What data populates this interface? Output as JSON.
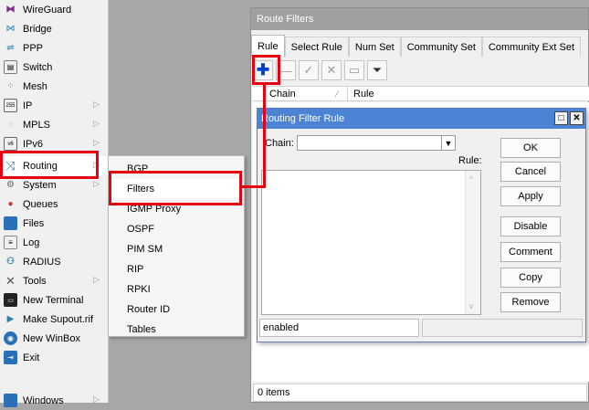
{
  "menu": {
    "items": [
      {
        "label": "WireGuard",
        "icon": "wireguard-icon",
        "arrow": false
      },
      {
        "label": "Bridge",
        "icon": "bridge-icon",
        "arrow": false
      },
      {
        "label": "PPP",
        "icon": "ppp-icon",
        "arrow": false
      },
      {
        "label": "Switch",
        "icon": "switch-icon",
        "arrow": false
      },
      {
        "label": "Mesh",
        "icon": "mesh-icon",
        "arrow": false
      },
      {
        "label": "IP",
        "icon": "ip-icon",
        "arrow": true
      },
      {
        "label": "MPLS",
        "icon": "mpls-icon",
        "arrow": true
      },
      {
        "label": "IPv6",
        "icon": "ipv6-icon",
        "arrow": true
      },
      {
        "label": "Routing",
        "icon": "routing-icon",
        "arrow": true
      },
      {
        "label": "System",
        "icon": "system-icon",
        "arrow": true
      },
      {
        "label": "Queues",
        "icon": "queues-icon",
        "arrow": false
      },
      {
        "label": "Files",
        "icon": "files-icon",
        "arrow": false
      },
      {
        "label": "Log",
        "icon": "log-icon",
        "arrow": false
      },
      {
        "label": "RADIUS",
        "icon": "radius-icon",
        "arrow": false
      },
      {
        "label": "Tools",
        "icon": "tools-icon",
        "arrow": true
      },
      {
        "label": "New Terminal",
        "icon": "terminal-icon",
        "arrow": false
      },
      {
        "label": "Make Supout.rif",
        "icon": "supout-icon",
        "arrow": false
      },
      {
        "label": "New WinBox",
        "icon": "winbox-icon",
        "arrow": false
      },
      {
        "label": "Exit",
        "icon": "exit-icon",
        "arrow": false
      },
      {
        "label": "Windows",
        "icon": "windows-icon",
        "arrow": true
      }
    ]
  },
  "submenu": {
    "items": [
      "BGP",
      "Filters",
      "IGMP Proxy",
      "OSPF",
      "PIM SM",
      "RIP",
      "RPKI",
      "Router ID",
      "Tables"
    ]
  },
  "route_filters": {
    "title": "Route Filters",
    "tabs": [
      "Rule",
      "Select Rule",
      "Num Set",
      "Community Set",
      "Community Ext Set"
    ],
    "columns": {
      "chain": "Chain",
      "rule": "Rule"
    },
    "status": "0 items"
  },
  "dialog": {
    "title": "Routing Filter Rule",
    "chain_label": "Chain:",
    "chain_value": "",
    "rule_label": "Rule:",
    "rule_value": "",
    "buttons": [
      "OK",
      "Cancel",
      "Apply",
      "Disable",
      "Comment",
      "Copy",
      "Remove"
    ],
    "status": "enabled"
  },
  "colors": {
    "highlight": "#e60012",
    "dialog_title": "#4c83d4",
    "add_button": "#0043c8"
  }
}
